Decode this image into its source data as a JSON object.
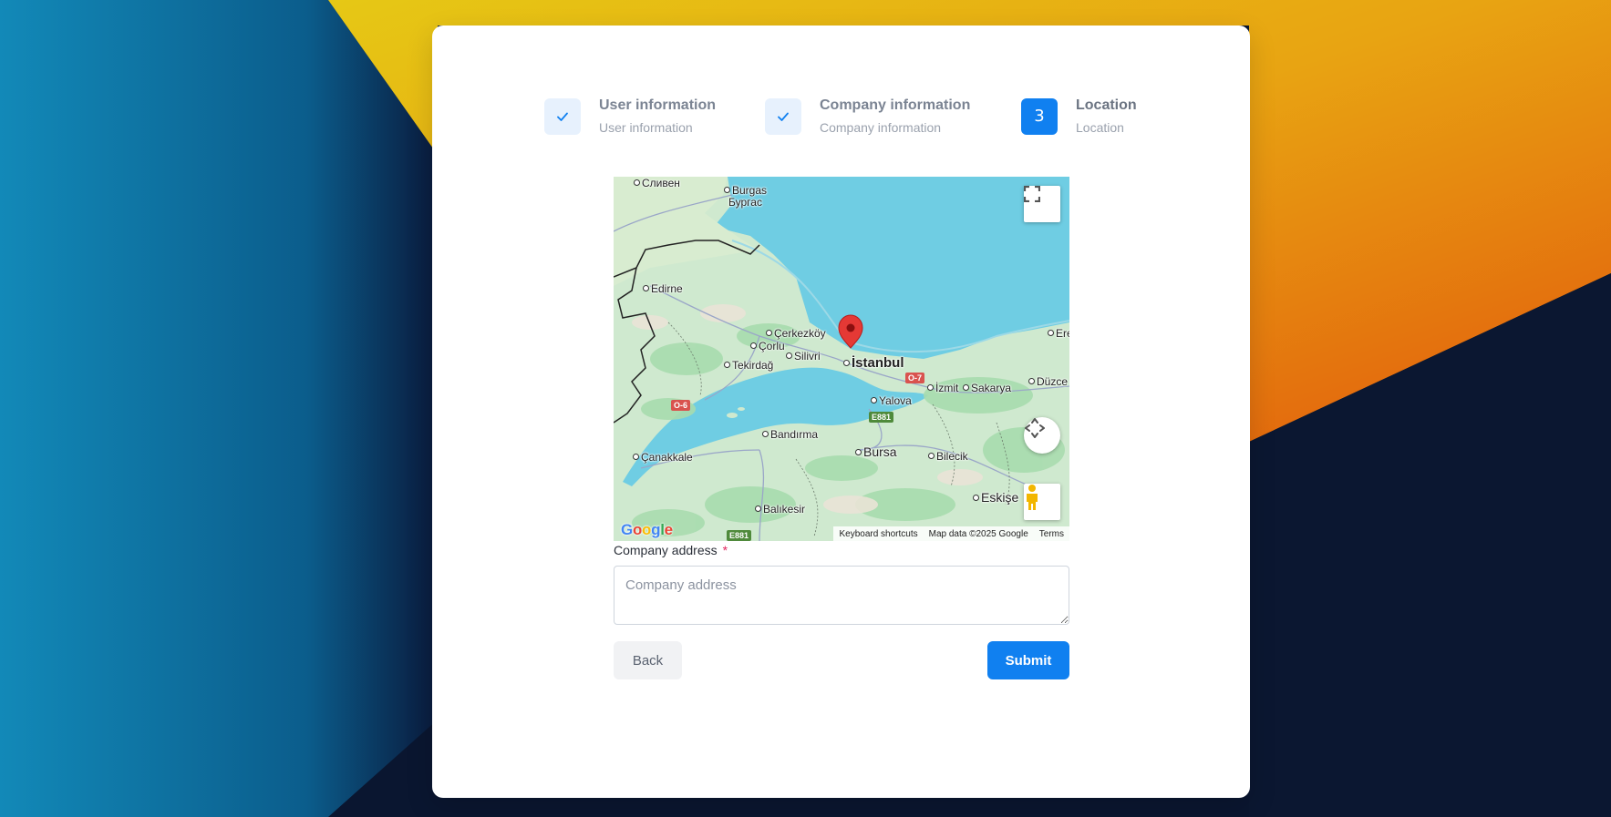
{
  "colors": {
    "accent": "#1080f0",
    "required": "#e0245e",
    "pin": "#e53935"
  },
  "steps": [
    {
      "title": "User information",
      "subtitle": "User information",
      "state": "complete",
      "icon": "check-icon"
    },
    {
      "title": "Company information",
      "subtitle": "Company information",
      "state": "complete",
      "icon": "check-icon"
    },
    {
      "title": "Location",
      "subtitle": "Location",
      "state": "active",
      "number": "3"
    }
  ],
  "map": {
    "places": {
      "sliven": "Сливен",
      "burgas": "Burgas",
      "burgas_cyr": "Бургас",
      "edirne": "Edirne",
      "cerkezkoy": "Çerkezköy",
      "corlu": "Çorlu",
      "silivri": "Silivri",
      "tekirdag": "Tekirdağ",
      "istanbul": "İstanbul",
      "yalova": "Yalova",
      "izmit": "İzmit",
      "sakarya": "Sakarya",
      "duzce": "Düzce",
      "ere": "Ere",
      "bandirma": "Bandırma",
      "bursa": "Bursa",
      "bilecik": "Bilecik",
      "canakkale": "Çanakkale",
      "balikesir": "Balıkesir",
      "eskisehir": "Eskişe"
    },
    "road_shields": {
      "o7": "O-7",
      "o6": "O-6",
      "e881a": "E881",
      "e881b": "E881"
    },
    "google_logo": [
      "G",
      "o",
      "o",
      "g",
      "l",
      "e"
    ],
    "attribution": {
      "shortcuts": "Keyboard shortcuts",
      "data": "Map data ©2025 Google",
      "terms": "Terms"
    },
    "controls": [
      "fullscreen-icon",
      "camera-control-icon",
      "pegman-icon"
    ]
  },
  "form": {
    "address_label": "Company address",
    "required_mark": "*",
    "address_placeholder": "Company address",
    "address_value": ""
  },
  "buttons": {
    "back": "Back",
    "submit": "Submit"
  }
}
